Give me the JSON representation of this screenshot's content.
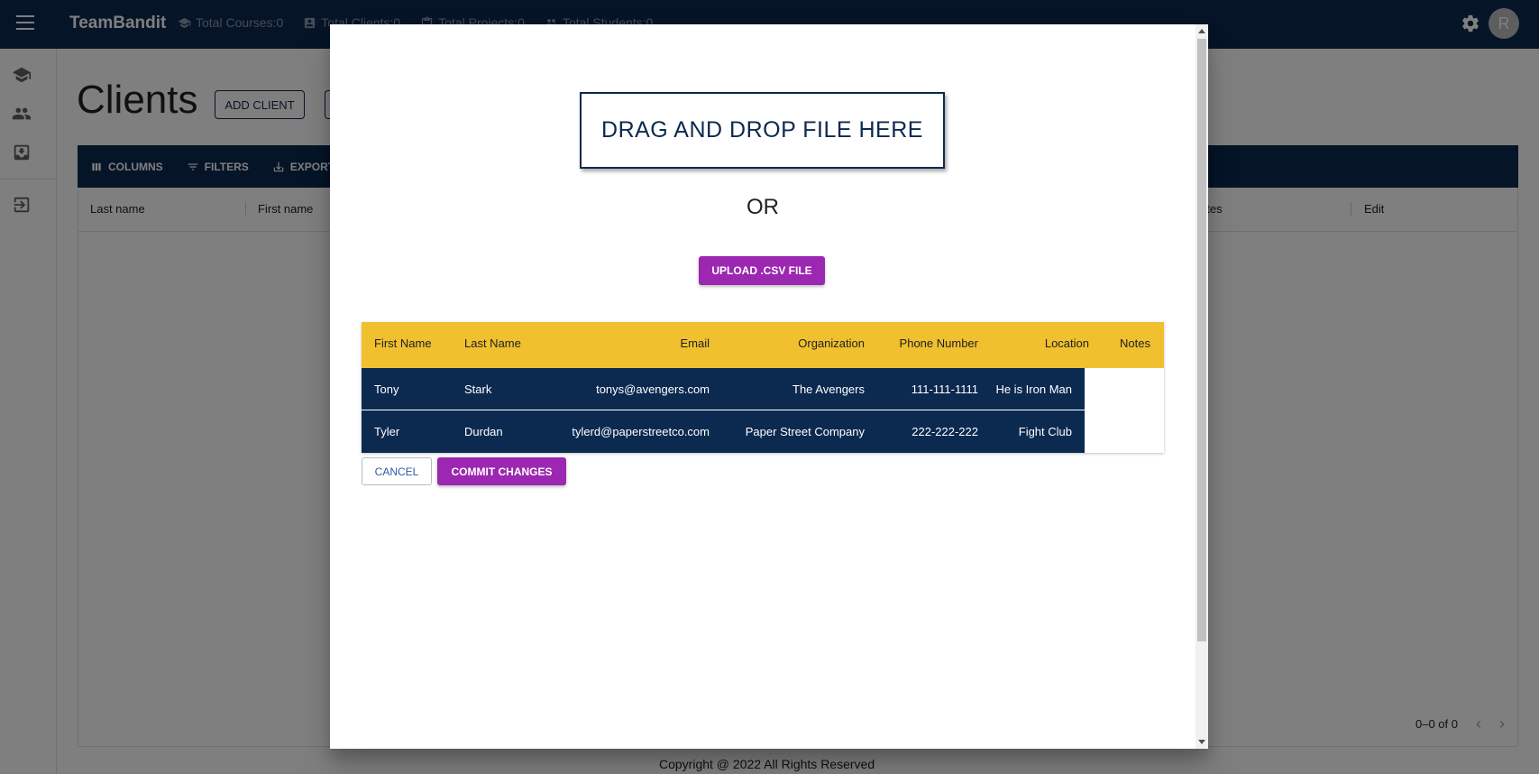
{
  "app": {
    "brand": "TeamBandit",
    "stats": [
      {
        "label": "Total Courses:0",
        "icon": "school-icon"
      },
      {
        "label": "Total Clients:0",
        "icon": "contact-icon"
      },
      {
        "label": "Total Projects:0",
        "icon": "clipboard-icon"
      },
      {
        "label": "Total Students:0",
        "icon": "people-icon"
      }
    ],
    "avatar_initial": "R"
  },
  "sidebar": {
    "items": [
      "school-icon",
      "people-icon",
      "inbox-icon",
      "logout-icon"
    ]
  },
  "page": {
    "title": "Clients",
    "add_client_label": "ADD CLIENT",
    "toolbar": {
      "columns_label": "COLUMNS",
      "filters_label": "FILTERS",
      "export_label": "EXPORT"
    },
    "grid_headers": {
      "last_name": "Last name",
      "first_name": "First name",
      "notes": "otes",
      "edit": "Edit"
    },
    "pagination": "0–0 of 0",
    "copyright": "Copyright @ 2022 All Rights Reserved"
  },
  "dialog": {
    "dropzone_label": "DRAG AND DROP FILE HERE",
    "or_label": "OR",
    "upload_label": "UPLOAD .CSV FILE",
    "cancel_label": "CANCEL",
    "commit_label": "COMMIT CHANGES",
    "table": {
      "headers": [
        "First Name",
        "Last Name",
        "Email",
        "Organization",
        "Phone Number",
        "Location",
        "Notes"
      ],
      "rows": [
        [
          "Tony",
          "Stark",
          "tonys@avengers.com",
          "The Avengers",
          "111-111-1111",
          "He is Iron Man",
          ""
        ],
        [
          "Tyler",
          "Durdan",
          "tylerd@paperstreetco.com",
          "Paper Street Company",
          "222-222-222",
          "Fight Club",
          ""
        ]
      ]
    }
  },
  "colors": {
    "navy": "#0c2950",
    "purple": "#9c27b0",
    "yellow": "#f0c02e"
  }
}
